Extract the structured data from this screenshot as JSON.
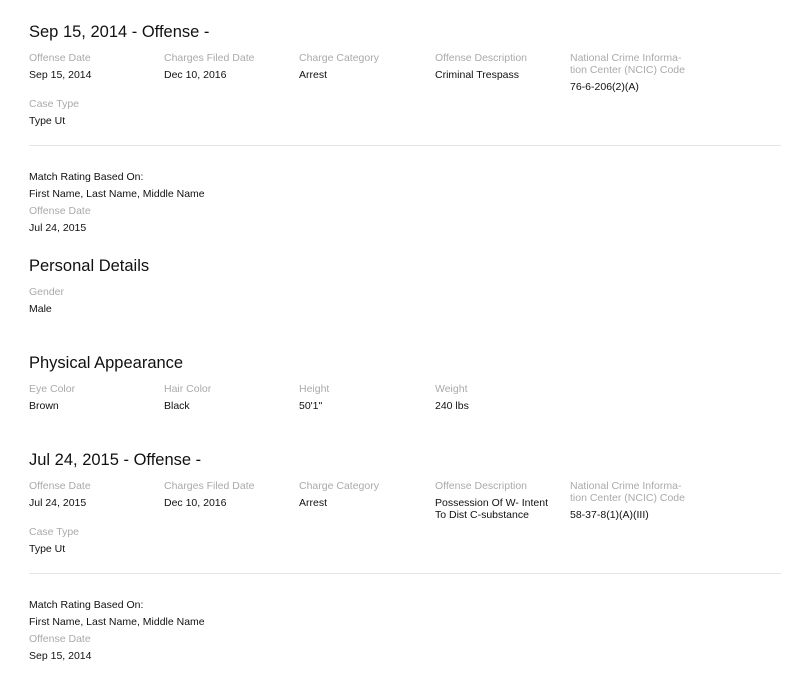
{
  "offense1": {
    "title": "Sep 15, 2014 - Offense -",
    "labels": {
      "offense_date": "Offense Date",
      "charges_filed_date": "Charges Filed Date",
      "charge_category": "Charge Category",
      "offense_description": "Offense Description",
      "ncic_line1": "National Crime Informa-",
      "ncic_line2": "tion Center (NCIC) Code",
      "case_type": "Case Type"
    },
    "values": {
      "offense_date": "Sep 15, 2014",
      "charges_filed_date": "Dec 10, 2016",
      "charge_category": "Arrest",
      "offense_description": "Criminal Trespass",
      "ncic_code": "76-6-206(2)(A)",
      "case_type": "Type Ut"
    },
    "match": {
      "label": "Match Rating Based On:",
      "value": "First Name, Last Name, Middle Name",
      "date_label": "Offense Date",
      "date_value": "Jul 24, 2015"
    }
  },
  "personal": {
    "title": "Personal Details",
    "gender_label": "Gender",
    "gender_value": "Male"
  },
  "physical": {
    "title": "Physical Appearance",
    "eye_label": "Eye Color",
    "eye_value": "Brown",
    "hair_label": "Hair Color",
    "hair_value": "Black",
    "height_label": "Height",
    "height_value": "50'1\"",
    "weight_label": "Weight",
    "weight_value": "240 lbs"
  },
  "offense2": {
    "title": "Jul 24, 2015 - Offense -",
    "labels": {
      "offense_date": "Offense Date",
      "charges_filed_date": "Charges Filed Date",
      "charge_category": "Charge Category",
      "offense_description": "Offense Description",
      "ncic_line1": "National Crime Informa-",
      "ncic_line2": "tion Center (NCIC) Code",
      "case_type": "Case Type"
    },
    "values": {
      "offense_date": "Jul 24, 2015",
      "charges_filed_date": "Dec 10, 2016",
      "charge_category": "Arrest",
      "offense_description_line1": "Possession Of W- Intent",
      "offense_description_line2": "To Dist C-substance",
      "ncic_code": "58-37-8(1)(A)(III)",
      "case_type": "Type Ut"
    },
    "match": {
      "label": "Match Rating Based On:",
      "value": "First Name, Last Name, Middle Name",
      "date_label": "Offense Date",
      "date_value": "Sep 15, 2014"
    }
  }
}
